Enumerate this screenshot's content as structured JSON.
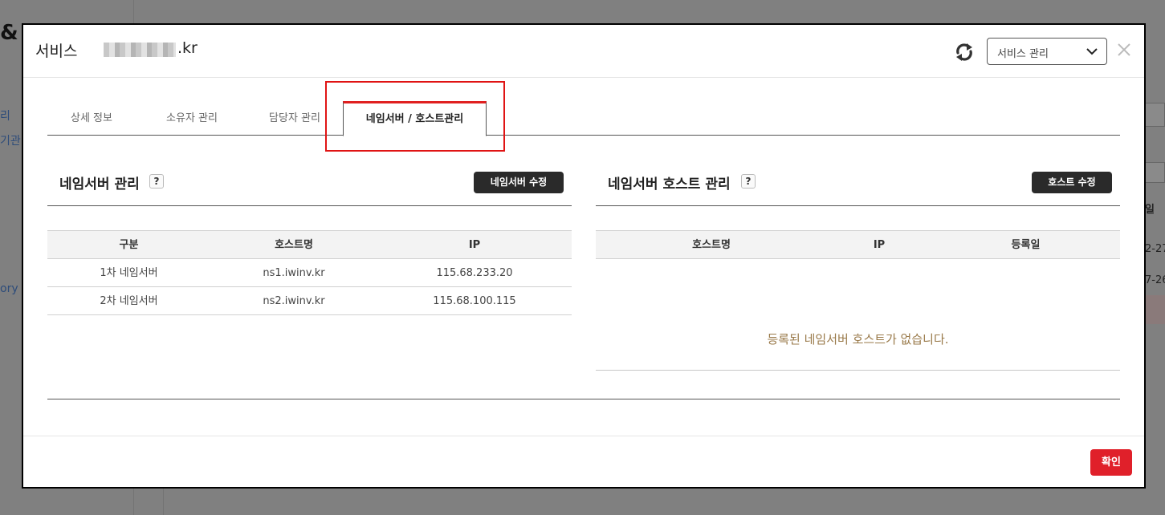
{
  "background": {
    "amp": "&",
    "left_items": [
      "리",
      "기관",
      "ory"
    ],
    "right_items": [
      "일",
      "2-27",
      "7-26"
    ]
  },
  "modal": {
    "title": "서비스",
    "domain_suffix": ".kr",
    "refresh_icon": "refresh-icon",
    "service_select": {
      "value": "서비스 관리"
    },
    "close_icon": "close-icon"
  },
  "tabs": [
    {
      "label": "상세 정보",
      "active": false
    },
    {
      "label": "소유자 관리",
      "active": false
    },
    {
      "label": "담당자 관리",
      "active": false
    },
    {
      "label": "네임서버 / 호스트관리",
      "active": true
    }
  ],
  "nameserver_panel": {
    "title": "네임서버 관리",
    "help": "?",
    "edit_button": "네임서버 수정",
    "columns": [
      "구분",
      "호스트명",
      "IP"
    ],
    "rows": [
      [
        "1차 네임서버",
        "ns1.iwinv.kr",
        "115.68.233.20"
      ],
      [
        "2차 네임서버",
        "ns2.iwinv.kr",
        "115.68.100.115"
      ]
    ]
  },
  "host_panel": {
    "title": "네임서버 호스트 관리",
    "help": "?",
    "edit_button": "호스트 수정",
    "columns": [
      "호스트명",
      "IP",
      "등록일"
    ],
    "empty_message": "등록된 네임서버 호스트가 없습니다."
  },
  "footer": {
    "confirm_button": "확인"
  },
  "colors": {
    "accent_red": "#e0202a",
    "highlight_red": "#e01414",
    "empty_text": "#9a7a4a"
  }
}
